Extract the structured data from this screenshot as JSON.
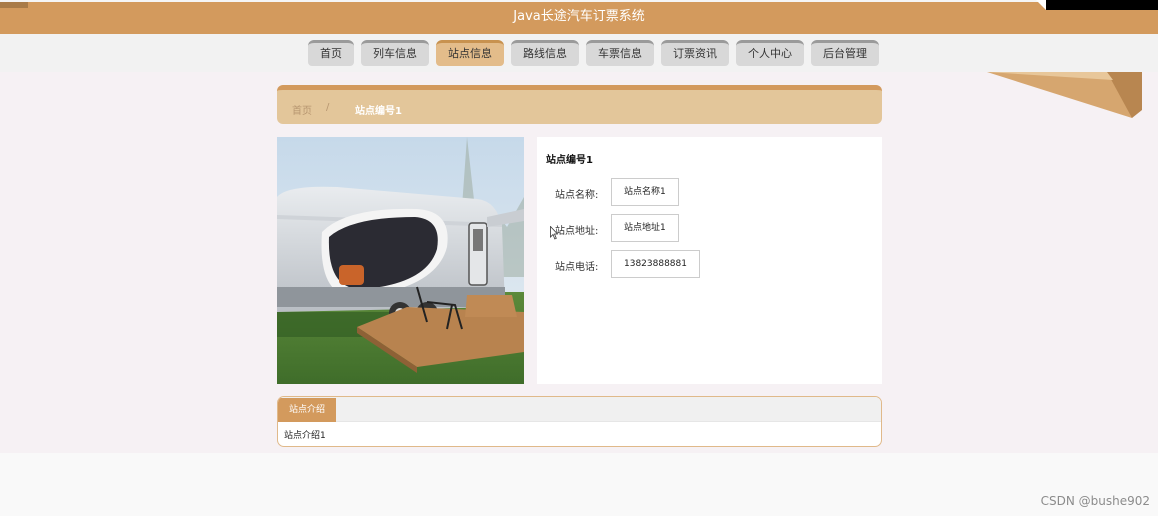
{
  "header": {
    "title": "Java长途汽车订票系统"
  },
  "nav": {
    "items": [
      {
        "label": "首页"
      },
      {
        "label": "列车信息"
      },
      {
        "label": "站点信息"
      },
      {
        "label": "路线信息"
      },
      {
        "label": "车票信息"
      },
      {
        "label": "订票资讯"
      },
      {
        "label": "个人中心"
      },
      {
        "label": "后台管理"
      }
    ],
    "active": "站点信息"
  },
  "breadcrumb": {
    "home": "首页",
    "separator": "/",
    "current": "站点编号1"
  },
  "detail": {
    "title": "站点编号1",
    "fields": [
      {
        "label": "站点名称:",
        "value": "站点名称1"
      },
      {
        "label": "站点地址:",
        "value": "站点地址1"
      },
      {
        "label": "站点电话:",
        "value": "13823888881"
      }
    ]
  },
  "intro": {
    "tab": "站点介绍",
    "content": "站点介绍1"
  },
  "watermark": "CSDN @bushe902",
  "colors": {
    "accent": "#d39a5d",
    "accent_light": "#e3c69a",
    "nav_active": "#e3bc8a"
  }
}
